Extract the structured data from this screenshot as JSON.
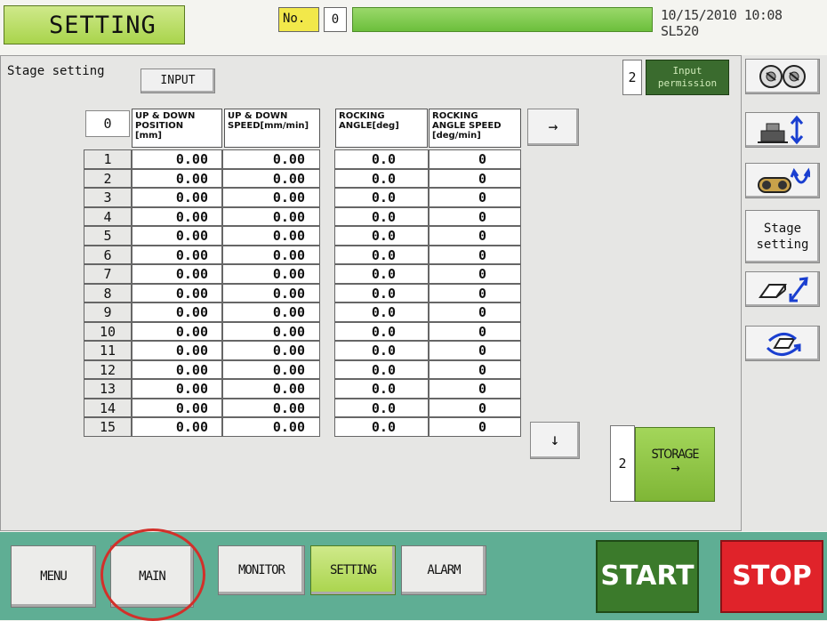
{
  "header": {
    "title": "SETTING",
    "no_label": "No.",
    "no_value": "0",
    "datetime": "10/15/2010 10:08 SL520"
  },
  "panel": {
    "stage_label": "Stage setting",
    "input_button": "INPUT",
    "permission_number": "2",
    "permission_label_1": "Input",
    "permission_label_2": "permission",
    "stage_start": "0"
  },
  "table": {
    "headers": [
      [
        "UP & DOWN",
        "POSITION",
        "[mm]"
      ],
      [
        "UP & DOWN",
        "SPEED[mm/min]"
      ],
      [
        "ROCKING",
        "ANGLE[deg]"
      ],
      [
        "ROCKING",
        "ANGLE SPEED",
        "[deg/min]"
      ]
    ],
    "rows": [
      {
        "idx": "1",
        "pos": "0.00",
        "speed": "0.00",
        "angle": "0.0",
        "angle_speed": "0"
      },
      {
        "idx": "2",
        "pos": "0.00",
        "speed": "0.00",
        "angle": "0.0",
        "angle_speed": "0"
      },
      {
        "idx": "3",
        "pos": "0.00",
        "speed": "0.00",
        "angle": "0.0",
        "angle_speed": "0"
      },
      {
        "idx": "4",
        "pos": "0.00",
        "speed": "0.00",
        "angle": "0.0",
        "angle_speed": "0"
      },
      {
        "idx": "5",
        "pos": "0.00",
        "speed": "0.00",
        "angle": "0.0",
        "angle_speed": "0"
      },
      {
        "idx": "6",
        "pos": "0.00",
        "speed": "0.00",
        "angle": "0.0",
        "angle_speed": "0"
      },
      {
        "idx": "7",
        "pos": "0.00",
        "speed": "0.00",
        "angle": "0.0",
        "angle_speed": "0"
      },
      {
        "idx": "8",
        "pos": "0.00",
        "speed": "0.00",
        "angle": "0.0",
        "angle_speed": "0"
      },
      {
        "idx": "9",
        "pos": "0.00",
        "speed": "0.00",
        "angle": "0.0",
        "angle_speed": "0"
      },
      {
        "idx": "10",
        "pos": "0.00",
        "speed": "0.00",
        "angle": "0.0",
        "angle_speed": "0"
      },
      {
        "idx": "11",
        "pos": "0.00",
        "speed": "0.00",
        "angle": "0.0",
        "angle_speed": "0"
      },
      {
        "idx": "12",
        "pos": "0.00",
        "speed": "0.00",
        "angle": "0.0",
        "angle_speed": "0"
      },
      {
        "idx": "13",
        "pos": "0.00",
        "speed": "0.00",
        "angle": "0.0",
        "angle_speed": "0"
      },
      {
        "idx": "14",
        "pos": "0.00",
        "speed": "0.00",
        "angle": "0.0",
        "angle_speed": "0"
      },
      {
        "idx": "15",
        "pos": "0.00",
        "speed": "0.00",
        "angle": "0.0",
        "angle_speed": "0"
      }
    ]
  },
  "nav": {
    "right_arrow": "→",
    "down_arrow": "↓",
    "storage_number": "2",
    "storage_label": "STORAGE",
    "storage_arrow": "→"
  },
  "sidebar": {
    "stage_setting_line1": "Stage",
    "stage_setting_line2": "setting",
    "icons": [
      "rollers-icon",
      "lift-up-down-icon",
      "rocking-icon",
      "tilt-diagonal-icon",
      "rotate-icon"
    ]
  },
  "footer": {
    "menu": "MENU",
    "main": "MAIN",
    "monitor": "MONITOR",
    "setting": "SETTING",
    "alarm": "ALARM",
    "start": "START",
    "stop": "STOP"
  },
  "colors": {
    "title_green": "#a9d44c",
    "start_green": "#3b7a2b",
    "stop_red": "#e0232a",
    "footer_teal": "#5fae94",
    "highlight_circle": "#d2302a"
  }
}
